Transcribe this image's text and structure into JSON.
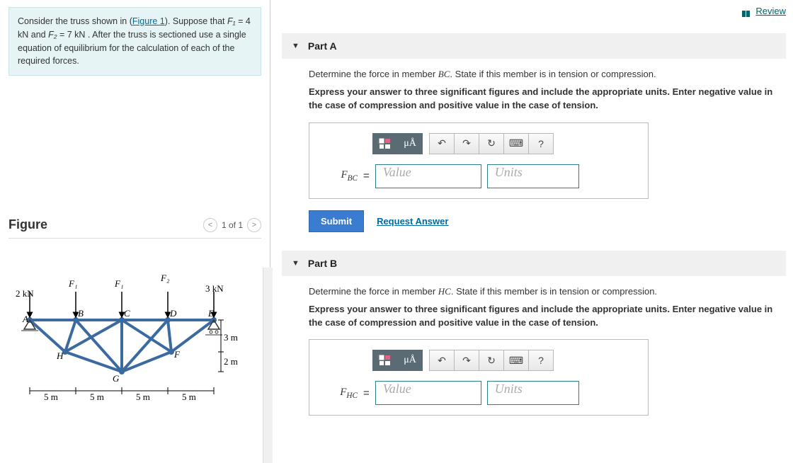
{
  "review": {
    "label": "Review"
  },
  "problem": {
    "intro_a": "Consider the truss shown in (",
    "fig_link": "Figure 1",
    "intro_b": "). Suppose that ",
    "f1_var": "F₁",
    "f1_eq": " = 4  kN",
    "and": " and ",
    "f2_var": "F₂",
    "f2_eq": " = 7  kN",
    "tail": " . After the truss is sectioned use a single equation of equilibrium for the calculation of each of the required forces."
  },
  "figure": {
    "title": "Figure",
    "page": "1 of 1",
    "labels": {
      "left_load": "2 kN",
      "right_load": "3 kN",
      "f1": "F₁",
      "f1b": "F₁",
      "f2": "F₂",
      "A": "A",
      "B": "B",
      "C": "C",
      "D": "D",
      "E": "E",
      "F": "F",
      "G": "G",
      "H": "H",
      "dim5": "5 m",
      "dim3": "3 m",
      "dim2": "2 m"
    }
  },
  "partA": {
    "title": "Part A",
    "question_a": "Determine the force in member ",
    "member": "BC",
    "question_b": ". State if this member is in tension or compression.",
    "instr": "Express your answer to three significant figures and include the appropriate units. Enter negative value in the case of compression and positive value in the case of tension.",
    "var_html": "F",
    "var_sub": "BC",
    "val_ph": "Value",
    "unit_ph": "Units",
    "submit": "Submit",
    "request": "Request Answer"
  },
  "partB": {
    "title": "Part B",
    "question_a": "Determine the force in member ",
    "member": "HC",
    "question_b": ". State if this member is in tension or compression.",
    "instr": "Express your answer to three significant figures and include the appropriate units. Enter negative value in the case of compression and positive value in the case of tension.",
    "var_html": "F",
    "var_sub": "HC",
    "val_ph": "Value",
    "unit_ph": "Units"
  },
  "toolbar": {
    "templates": "⬚",
    "mu": "μÅ",
    "undo": "↶",
    "redo": "↷",
    "reset": "↻",
    "keyboard": "⌨",
    "help": "?"
  }
}
